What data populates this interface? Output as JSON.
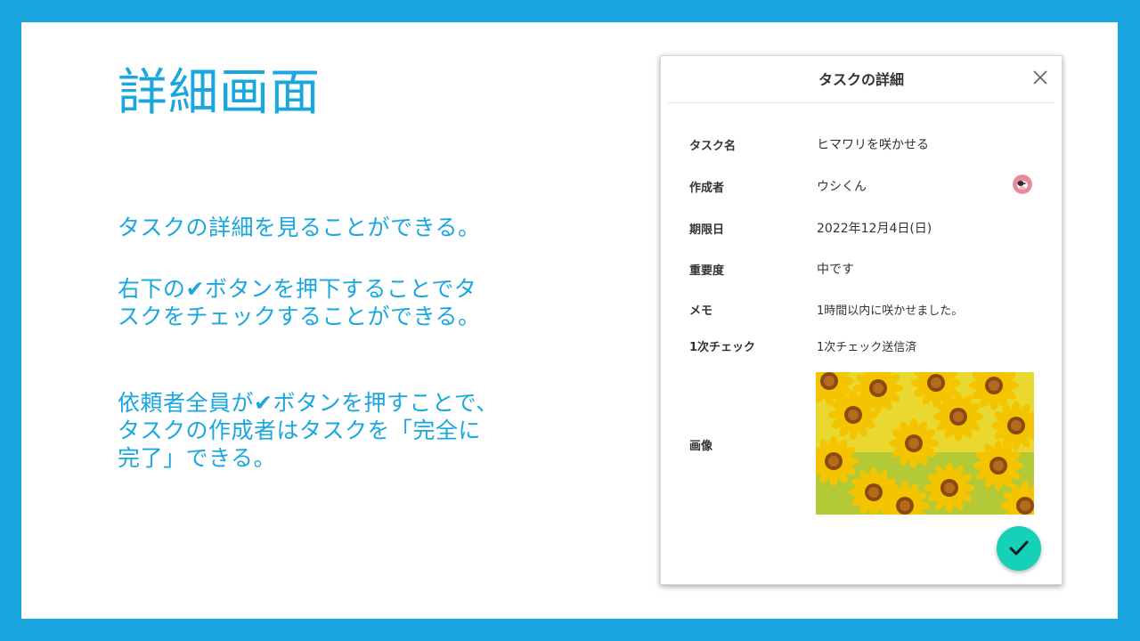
{
  "slide": {
    "title": "詳細画面",
    "paragraphs": [
      [
        "タスクの詳細を見ることができる。"
      ],
      [
        "右下の✔ボタンを押下することでタ",
        "スクをチェックすることができる。"
      ],
      [
        "依頼者全員が✔ボタンを押すことで、",
        "タスクの作成者はタスクを「完全に",
        "完了」できる。"
      ]
    ]
  },
  "dialog": {
    "title": "タスクの詳細",
    "close_icon": "close-icon",
    "fields": {
      "task_name": {
        "label": "タスク名",
        "value": "ヒマワリを咲かせる"
      },
      "creator": {
        "label": "作成者",
        "value": "ウシくん",
        "avatar_icon": "cow-avatar-icon"
      },
      "due_date": {
        "label": "期限日",
        "value": "2022年12月4日(日)"
      },
      "importance": {
        "label": "重要度",
        "value": "中です"
      },
      "memo": {
        "label": "メモ",
        "value": "1時間以内に咲かせました。"
      },
      "first_check": {
        "label": "1次チェック",
        "value": "1次チェック送信済"
      },
      "image": {
        "label": "画像",
        "content": "sunflower-field-photo"
      }
    },
    "check_button_icon": "check-icon"
  },
  "colors": {
    "accent": "#1aa7e0",
    "fab": "#14d1b8",
    "text": "#333333",
    "background": "#ffffff"
  }
}
